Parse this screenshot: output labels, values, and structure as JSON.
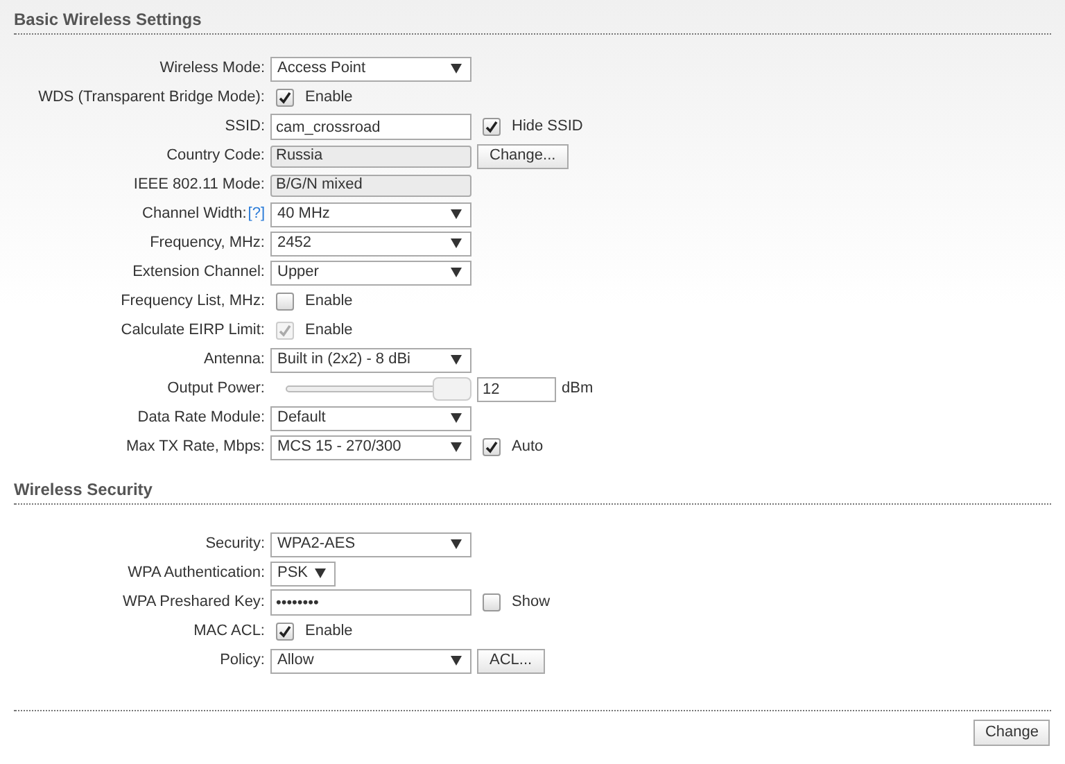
{
  "sections": [
    {
      "title": "Basic Wireless Settings",
      "rows": [
        {
          "kind": "select",
          "label": "Wireless Mode:",
          "value": "Access Point"
        },
        {
          "kind": "checkbox",
          "label": "WDS (Transparent Bridge Mode):",
          "checked": true,
          "disabled": false,
          "text": "Enable"
        },
        {
          "kind": "text",
          "label": "SSID:",
          "value": "cam_crossroad",
          "extra": {
            "kind": "checkbox",
            "checked": true,
            "text": "Hide SSID"
          }
        },
        {
          "kind": "readonly",
          "label": "Country Code:",
          "value": "Russia",
          "extra": {
            "kind": "button",
            "text": "Change..."
          }
        },
        {
          "kind": "readonly",
          "label": "IEEE 802.11 Mode:",
          "value": "B/G/N mixed"
        },
        {
          "kind": "select",
          "label": "Channel Width:",
          "help": "[?]",
          "value": "40 MHz"
        },
        {
          "kind": "select",
          "label": "Frequency, MHz:",
          "value": "2452"
        },
        {
          "kind": "select",
          "label": "Extension Channel:",
          "value": "Upper"
        },
        {
          "kind": "checkbox",
          "label": "Frequency List, MHz:",
          "checked": false,
          "disabled": false,
          "text": "Enable"
        },
        {
          "kind": "checkbox",
          "label": "Calculate EIRP Limit:",
          "checked": true,
          "disabled": true,
          "text": "Enable"
        },
        {
          "kind": "select",
          "label": "Antenna:",
          "value": "Built in (2x2) - 8 dBi"
        },
        {
          "kind": "slider",
          "label": "Output Power:",
          "level": 1,
          "value": "12",
          "unit": "dBm"
        },
        {
          "kind": "select",
          "label": "Data Rate Module:",
          "value": "Default"
        },
        {
          "kind": "select",
          "label": "Max TX Rate, Mbps:",
          "value": "MCS 15 - 270/300",
          "extra": {
            "kind": "checkbox",
            "checked": true,
            "text": "Auto"
          }
        }
      ]
    },
    {
      "title": "Wireless Security",
      "rows": [
        {
          "kind": "select",
          "label": "Security:",
          "value": "WPA2-AES"
        },
        {
          "kind": "short_select",
          "label": "WPA Authentication:",
          "value": "PSK"
        },
        {
          "kind": "text",
          "label": "WPA Preshared Key:",
          "value": "••••••••",
          "extra": {
            "kind": "checkbox",
            "checked": false,
            "text": "Show"
          }
        },
        {
          "kind": "checkbox",
          "label": "MAC ACL:",
          "checked": true,
          "disabled": false,
          "text": "Enable"
        },
        {
          "kind": "select",
          "label": "Policy:",
          "value": "Allow",
          "extra": {
            "kind": "button",
            "text": "ACL..."
          }
        }
      ]
    }
  ],
  "footer": {
    "button": "Change"
  }
}
